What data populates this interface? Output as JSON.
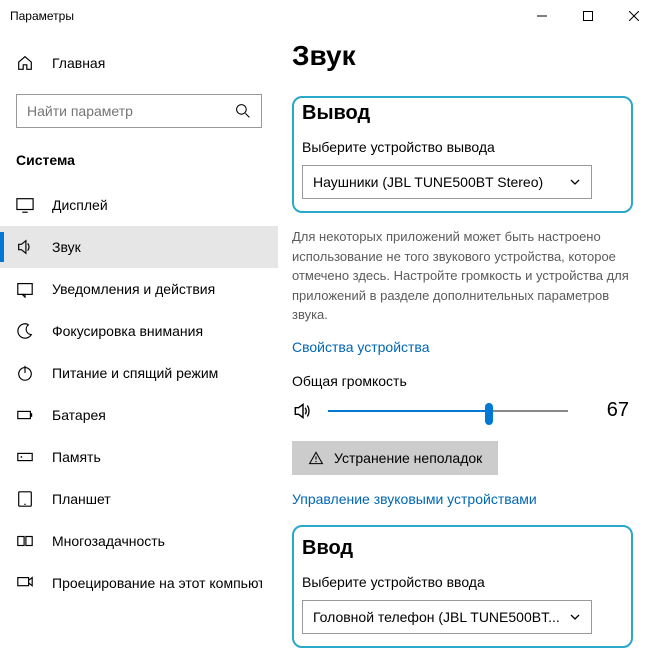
{
  "window": {
    "title": "Параметры"
  },
  "sidebar": {
    "home": "Главная",
    "search_placeholder": "Найти параметр",
    "category": "Система",
    "items": [
      {
        "label": "Дисплей"
      },
      {
        "label": "Звук"
      },
      {
        "label": "Уведомления и действия"
      },
      {
        "label": "Фокусировка внимания"
      },
      {
        "label": "Питание и спящий режим"
      },
      {
        "label": "Батарея"
      },
      {
        "label": "Память"
      },
      {
        "label": "Планшет"
      },
      {
        "label": "Многозадачность"
      },
      {
        "label": "Проецирование на этот компьютер"
      }
    ]
  },
  "main": {
    "title": "Звук",
    "output": {
      "heading": "Вывод",
      "select_label": "Выберите устройство вывода",
      "selected": "Наушники (JBL TUNE500BT Stereo)",
      "desc": "Для некоторых приложений может быть настроено использование не того звукового устройства, которое отмечено здесь. Настройте громкость и устройства для приложений в разделе дополнительных параметров звука.",
      "props_link": "Свойства устройства",
      "volume_label": "Общая громкость",
      "volume": 67,
      "troubleshoot": "Устранение неполадок",
      "manage_link": "Управление звуковыми устройствами"
    },
    "input": {
      "heading": "Ввод",
      "select_label": "Выберите устройство ввода",
      "selected": "Головной телефон (JBL TUNE500BT..."
    }
  }
}
